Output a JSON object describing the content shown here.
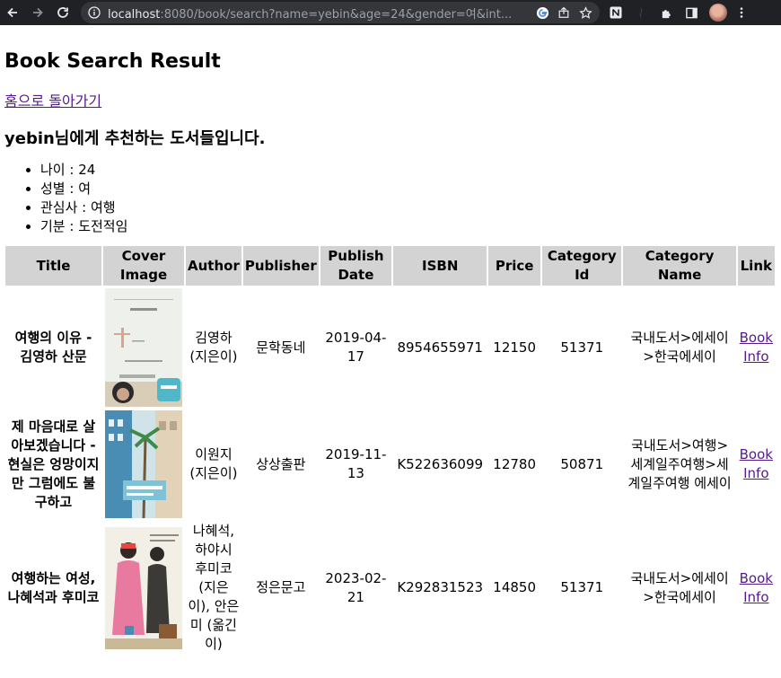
{
  "browser": {
    "url_host": "localhost",
    "url_rest": ":8080/book/search?name=yebin&age=24&gender=여&int..."
  },
  "page": {
    "title": "Book Search Result",
    "home_link": "홈으로 돌아가기",
    "subtitle": "yebin님에게 추천하는 도서들입니다.",
    "profile": [
      "나이 : 24",
      "성별 : 여",
      "관심사 : 여행",
      "기분 : 도전적임"
    ]
  },
  "table": {
    "headers": [
      "Title",
      "Cover Image",
      "Author",
      "Publisher",
      "Publish Date",
      "ISBN",
      "Price",
      "Category Id",
      "Category Name",
      "Link"
    ],
    "rows": [
      {
        "title": "여행의 이유 - 김영하 산문",
        "cover": "cover-1",
        "author": "김영하 (지은이)",
        "publisher": "문학동네",
        "date": "2019-04-17",
        "isbn": "8954655971",
        "price": "12150",
        "category_id": "51371",
        "category_name": "국내도서>에세이>한국에세이",
        "link": "Book Info"
      },
      {
        "title": "제 마음대로 살아보겠습니다 - 현실은 엉망이지만 그럼에도 불구하고",
        "cover": "cover-2",
        "author": "이원지 (지은이)",
        "publisher": "상상출판",
        "date": "2019-11-13",
        "isbn": "K522636099",
        "price": "12780",
        "category_id": "50871",
        "category_name": "국내도서>여행>세계일주여행>세계일주여행 에세이",
        "link": "Book Info"
      },
      {
        "title": "여행하는 여성, 나혜석과 후미코",
        "cover": "cover-3",
        "author": "나혜석, 하야시 후미코 (지은이), 안은미 (옮긴이)",
        "publisher": "정은문고",
        "date": "2023-02-21",
        "isbn": "K292831523",
        "price": "14850",
        "category_id": "51371",
        "category_name": "국내도서>에세이>한국에세이",
        "link": "Book Info"
      }
    ]
  }
}
